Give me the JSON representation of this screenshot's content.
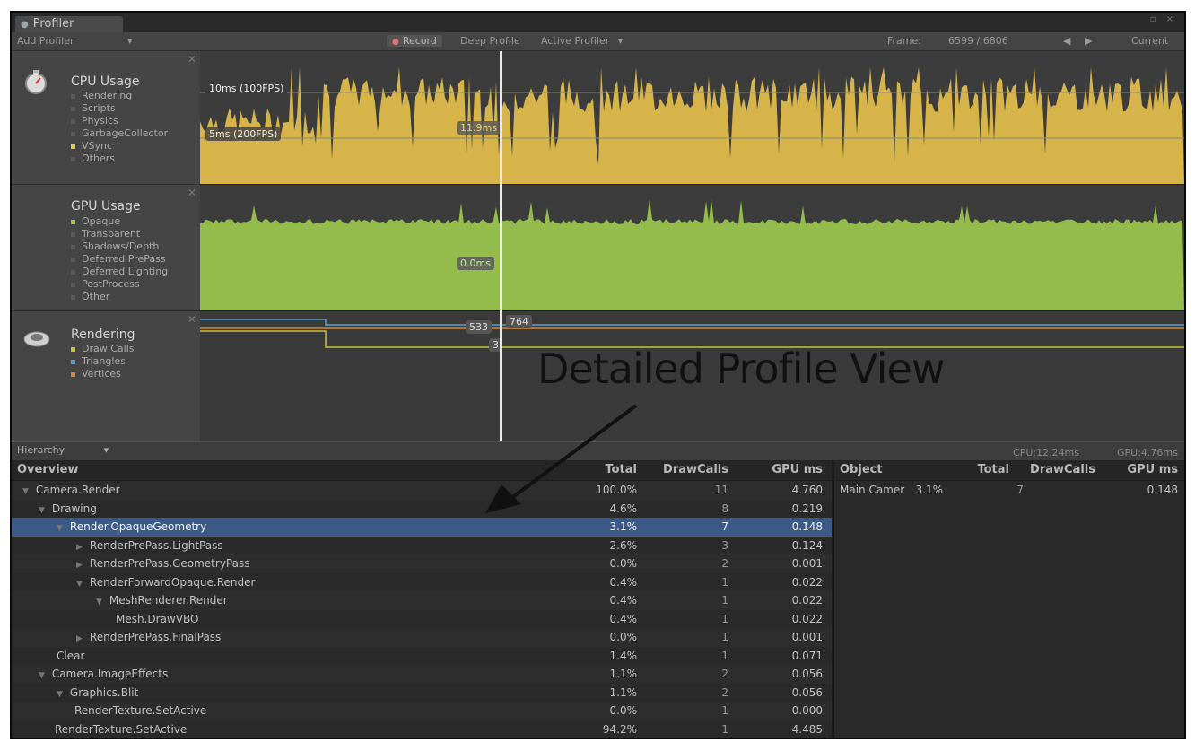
{
  "window": {
    "tab_title": "Profiler",
    "controls": "▫ ×"
  },
  "toolbar": {
    "add_profiler": "Add Profiler",
    "record": "Record",
    "deep_profile": "Deep Profile",
    "active_profiler": "Active Profiler",
    "frame_label": "Frame:",
    "frame_value": "6599 / 6806",
    "prev": "◀",
    "next": "▶",
    "current": "Current"
  },
  "cpu": {
    "title": "CPU Usage",
    "legend": [
      "Rendering",
      "Scripts",
      "Physics",
      "GarbageCollector",
      "VSync",
      "Others"
    ],
    "legend_colors": [
      "#5a5a5a",
      "#5a5a5a",
      "#5a5a5a",
      "#5a5a5a",
      "#e6c84a",
      "#5a5a5a"
    ],
    "label_10ms": "10ms (100FPS)",
    "label_5ms": "5ms (200FPS)",
    "cursor_value": "11.9ms",
    "fill_color": "#d6b44a"
  },
  "gpu": {
    "title": "GPU Usage",
    "legend": [
      "Opaque",
      "Transparent",
      "Shadows/Depth",
      "Deferred PrePass",
      "Deferred Lighting",
      "PostProcess",
      "Other"
    ],
    "legend_colors": [
      "#9dc24a",
      "#5a5a5a",
      "#5a5a5a",
      "#5a5a5a",
      "#5a5a5a",
      "#5a5a5a",
      "#5a5a5a"
    ],
    "cursor_value": "0.0ms",
    "fill_color": "#94bc4c"
  },
  "rendering": {
    "title": "Rendering",
    "legend": [
      "Draw Calls",
      "Triangles",
      "Vertices"
    ],
    "legend_colors": [
      "#c9c23a",
      "#5aa0c8",
      "#d08a40"
    ],
    "value_533": "533",
    "value_764": "764",
    "value_3": "3"
  },
  "annotation": "Detailed Profile View",
  "hierarchy": {
    "mode": "Hierarchy",
    "cpu_time": "CPU:12.24ms",
    "gpu_time": "GPU:4.76ms",
    "columns": {
      "overview": "Overview",
      "total": "Total",
      "drawcalls": "DrawCalls",
      "gpu_ms": "GPU ms"
    },
    "rows": [
      {
        "name": "Camera.Render",
        "total": "100.0%",
        "drawcalls": "11",
        "gpu": "4.760",
        "tri": "▼"
      },
      {
        "name": "Drawing",
        "total": "4.6%",
        "drawcalls": "8",
        "gpu": "0.219",
        "tri": "▼"
      },
      {
        "name": "Render.OpaqueGeometry",
        "total": "3.1%",
        "drawcalls": "7",
        "gpu": "0.148",
        "tri": "▼"
      },
      {
        "name": "RenderPrePass.LightPass",
        "total": "2.6%",
        "drawcalls": "3",
        "gpu": "0.124",
        "tri": "▶"
      },
      {
        "name": "RenderPrePass.GeometryPass",
        "total": "0.0%",
        "drawcalls": "2",
        "gpu": "0.001",
        "tri": "▶"
      },
      {
        "name": "RenderForwardOpaque.Render",
        "total": "0.4%",
        "drawcalls": "1",
        "gpu": "0.022",
        "tri": "▼"
      },
      {
        "name": "MeshRenderer.Render",
        "total": "0.4%",
        "drawcalls": "1",
        "gpu": "0.022",
        "tri": "▼"
      },
      {
        "name": "Mesh.DrawVBO",
        "total": "0.4%",
        "drawcalls": "1",
        "gpu": "0.022",
        "tri": ""
      },
      {
        "name": "RenderPrePass.FinalPass",
        "total": "0.0%",
        "drawcalls": "1",
        "gpu": "0.001",
        "tri": "▶"
      },
      {
        "name": "Clear",
        "total": "1.4%",
        "drawcalls": "1",
        "gpu": "0.071",
        "tri": ""
      },
      {
        "name": "Camera.ImageEffects",
        "total": "1.1%",
        "drawcalls": "2",
        "gpu": "0.056",
        "tri": "▼"
      },
      {
        "name": "Graphics.Blit",
        "total": "1.1%",
        "drawcalls": "2",
        "gpu": "0.056",
        "tri": "▼"
      },
      {
        "name": "RenderTexture.SetActive",
        "total": "0.0%",
        "drawcalls": "1",
        "gpu": "0.000",
        "tri": ""
      },
      {
        "name": "RenderTexture.SetActive",
        "total": "94.2%",
        "drawcalls": "1",
        "gpu": "4.485",
        "tri": ""
      }
    ]
  },
  "object_table": {
    "columns": {
      "object": "Object",
      "total": "Total",
      "drawcalls": "DrawCalls",
      "gpu_ms": "GPU ms"
    },
    "rows": [
      {
        "object": "Main Camer",
        "total": "3.1%",
        "drawcalls": "7",
        "gpu": "0.148"
      }
    ]
  }
}
